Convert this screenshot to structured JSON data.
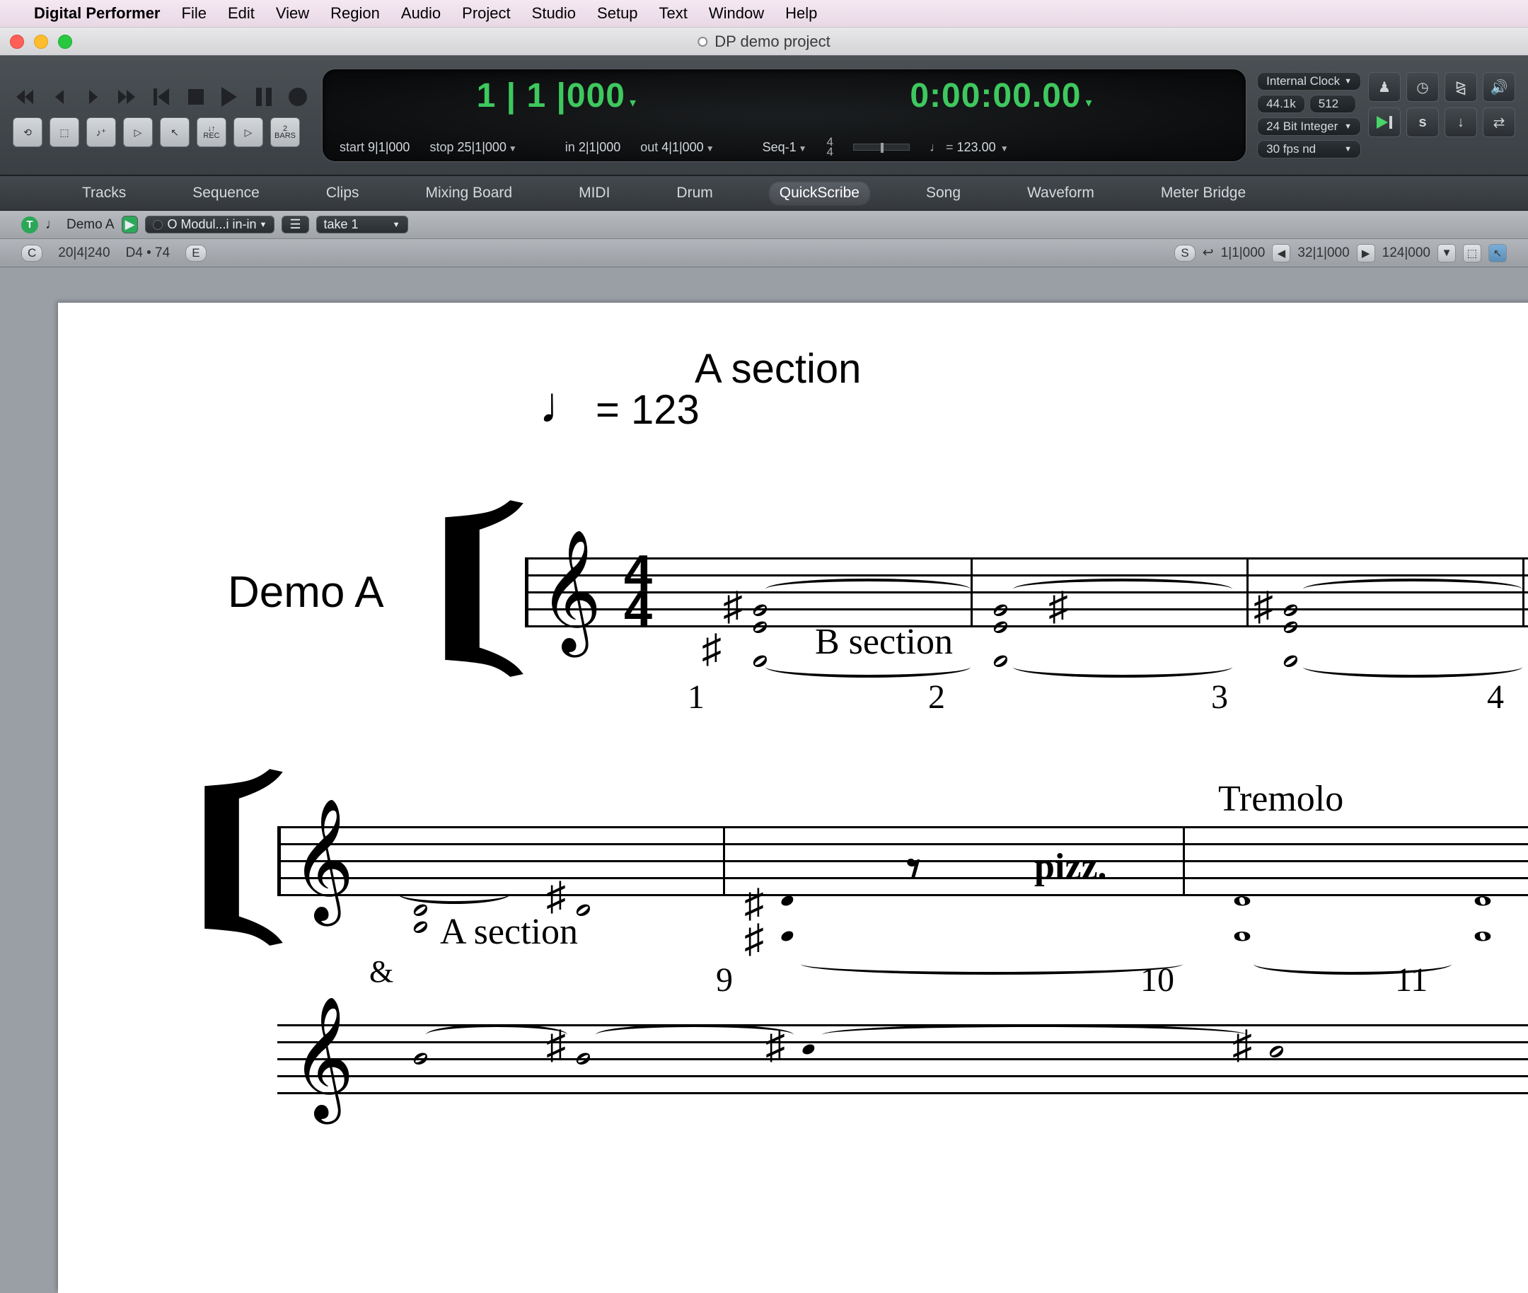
{
  "menubar": {
    "app": "Digital Performer",
    "items": [
      "File",
      "Edit",
      "View",
      "Region",
      "Audio",
      "Project",
      "Studio",
      "Setup",
      "Text",
      "Window",
      "Help"
    ]
  },
  "window": {
    "title": "DP demo project"
  },
  "counter": {
    "bars": "1 | 1 |000",
    "time": "0:00:00.00",
    "start_lbl": "start",
    "start_val": "9|1|000",
    "stop_lbl": "stop",
    "stop_val": "25|1|000",
    "in_lbl": "in",
    "in_val": "2|1|000",
    "out_lbl": "out",
    "out_val": "4|1|000",
    "seq": "Seq-1",
    "meter_top": "4",
    "meter_bot": "4",
    "tempo_note": "♩",
    "tempo_eq": "=",
    "tempo_val": "123.00"
  },
  "sync": {
    "clock": "Internal Clock",
    "rate": "44.1k",
    "buffer": "512",
    "format": "24 Bit Integer",
    "fps": "30 fps nd"
  },
  "tabs": [
    "Tracks",
    "Sequence",
    "Clips",
    "Mixing Board",
    "MIDI",
    "Drum",
    "QuickScribe",
    "Song",
    "Waveform",
    "Meter Bridge"
  ],
  "active_tab": "QuickScribe",
  "toolbar1": {
    "track_badge": "T",
    "track_name": "Demo A",
    "output": "O Modul...i in-in",
    "take": "take 1"
  },
  "toolbar2": {
    "c_btn": "C",
    "pos": "20|4|240",
    "note": "D4 • 74",
    "e_btn": "E",
    "s_btn": "S",
    "range1": "1|1|000",
    "range2": "32|1|000",
    "range3": "124|000"
  },
  "score": {
    "section_title": "A section",
    "tempo": "= 123",
    "track": "Demo A",
    "ts_top": "4",
    "ts_bot": "4",
    "ann_b": "B section",
    "ann_trem": "Tremolo",
    "ann_pizz": "pizz.",
    "ann_a2": "A section",
    "amp": "&",
    "bar1": "1",
    "bar2": "2",
    "bar3": "3",
    "bar4": "4",
    "bar9": "9",
    "bar10": "10",
    "bar11": "11"
  }
}
